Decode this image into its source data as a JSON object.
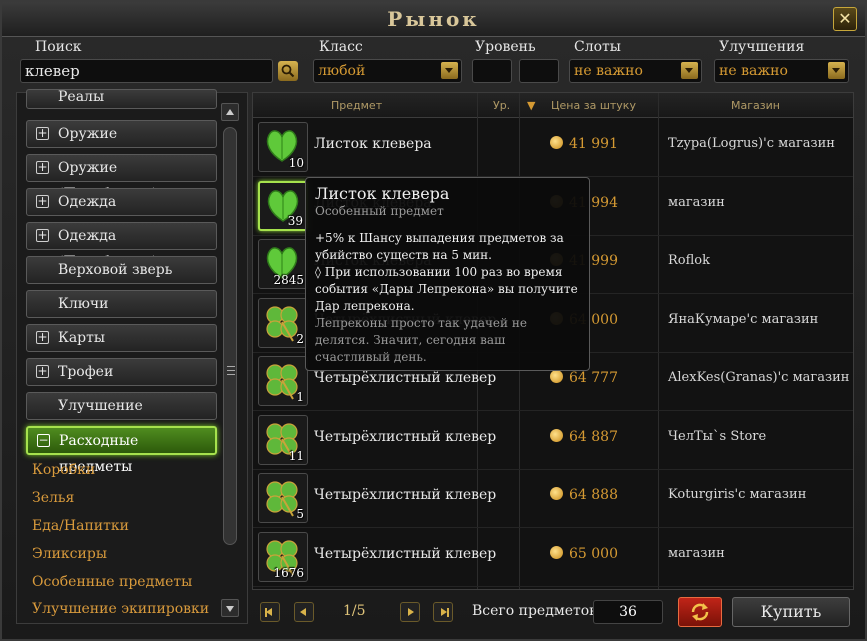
{
  "window": {
    "title": "Рынок",
    "close_label": "✕"
  },
  "filters": {
    "search_label": "Поиск",
    "search_value": "клевер",
    "class_label": "Класс",
    "class_value": "любой",
    "level_label": "Уровень",
    "level_min": "",
    "level_max": "",
    "slots_label": "Слоты",
    "slots_value": "не важно",
    "upgrades_label": "Улучшения",
    "upgrades_value": "не важно"
  },
  "sidebar": {
    "categories": [
      {
        "label": "Реалы",
        "expandable": false
      },
      {
        "label": "Оружие",
        "expandable": true
      },
      {
        "label": "Оружие (Преобразец)",
        "expandable": true
      },
      {
        "label": "Одежда",
        "expandable": true
      },
      {
        "label": "Одежда (Преобразец)",
        "expandable": true
      },
      {
        "label": "Верховой зверь",
        "expandable": false
      },
      {
        "label": "Ключи",
        "expandable": false
      },
      {
        "label": "Карты",
        "expandable": true
      },
      {
        "label": "Трофеи",
        "expandable": true
      },
      {
        "label": "Улучшение предметов",
        "expandable": false
      },
      {
        "label": "Расходные предметы",
        "expandable": true,
        "active": true
      }
    ],
    "subcategories": [
      "Коробки",
      "Зелья",
      "Еда/Напитки",
      "Эликсиры",
      "Особенные предметы",
      "Улучшение экипировки"
    ]
  },
  "table": {
    "headers": {
      "item": "Предмет",
      "level": "Ур.",
      "sort_indicator": "▼",
      "price": "Цена за штуку",
      "shop": "Магазин"
    },
    "rows": [
      {
        "name": "Листок клевера",
        "qty": "10",
        "price": "41 991",
        "shop": "Tzypa(Logrus)'с магазин",
        "icon": "clover-leaf-icon"
      },
      {
        "name": "Листок клевера",
        "qty": "39",
        "price": "41 994",
        "shop": "магазин",
        "icon": "clover-leaf-icon"
      },
      {
        "name": "Листок клевера",
        "qty": "2845",
        "price": "41 999",
        "shop": "Roflok",
        "icon": "clover-leaf-icon"
      },
      {
        "name": "Четырёхлистный клевер",
        "qty": "2",
        "price": "64 000",
        "shop": "ЯнаКумаре'с магазин",
        "icon": "four-leaf-clover-icon"
      },
      {
        "name": "Четырёхлистный клевер",
        "qty": "1",
        "price": "64 777",
        "shop": "AlexKes(Granas)'с магазин",
        "icon": "four-leaf-clover-icon"
      },
      {
        "name": "Четырёхлистный клевер",
        "qty": "11",
        "price": "64 887",
        "shop": "ЧелТы`s Store",
        "icon": "four-leaf-clover-icon"
      },
      {
        "name": "Четырёхлистный клевер",
        "qty": "5",
        "price": "64 888",
        "shop": "Koturgiris'с магазин",
        "icon": "four-leaf-clover-icon"
      },
      {
        "name": "Четырёхлистный клевер",
        "qty": "1676",
        "price": "65 000",
        "shop": "магазин",
        "icon": "four-leaf-clover-icon"
      }
    ]
  },
  "tooltip": {
    "title": "Листок клевера",
    "subtitle": "Особенный предмет",
    "effect": "+5% к Шансу выпадения предметов за убийство существ на 5 мин.",
    "bonus": "◊ При использовании 100 раз во время события «Дары Лепрекона» вы получите Дар лепрекона.",
    "flavor": "Лепреконы просто так удачей не делятся. Значит, сегодня ваш счастливый день."
  },
  "footer": {
    "page_info": "1/5",
    "total_label": "Всего предметов",
    "total_value": "36",
    "buy_label": "Купить"
  },
  "colors": {
    "accent_gold": "#d59a33",
    "active_green": "#4f8c1f",
    "refresh_red": "#c02418"
  }
}
